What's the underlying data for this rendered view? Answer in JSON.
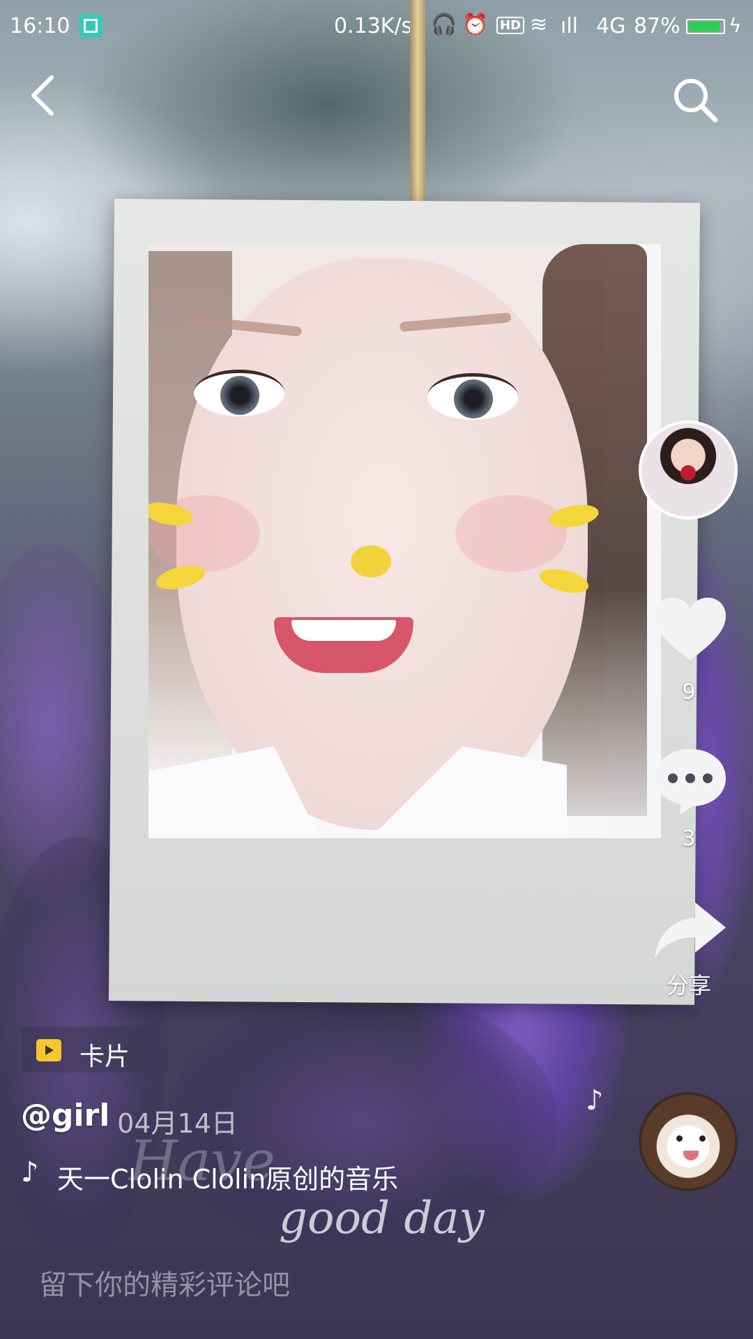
{
  "status_bar": {
    "time": "16:10",
    "network_speed": "0.13K/s",
    "hd_label": "HD",
    "network_type": "4G",
    "battery_percent": "87%",
    "battery_level": 0.87
  },
  "video": {
    "overlay_text_line1": "Have",
    "overlay_text_line2": "good day"
  },
  "actions": {
    "like_count": "9",
    "comment_count": "3",
    "share_label": "分享"
  },
  "info": {
    "card_tag_label": "卡片",
    "author": "@girl",
    "date": "· 04月14日",
    "music_title": "天一Clolin   Clolin原创的音乐"
  },
  "comment_input": {
    "placeholder": "留下你的精彩评论吧"
  },
  "colors": {
    "battery_fill": "#2bd150",
    "card_icon": "#f6c62d",
    "status_app_icon": "#3ac7b8"
  }
}
